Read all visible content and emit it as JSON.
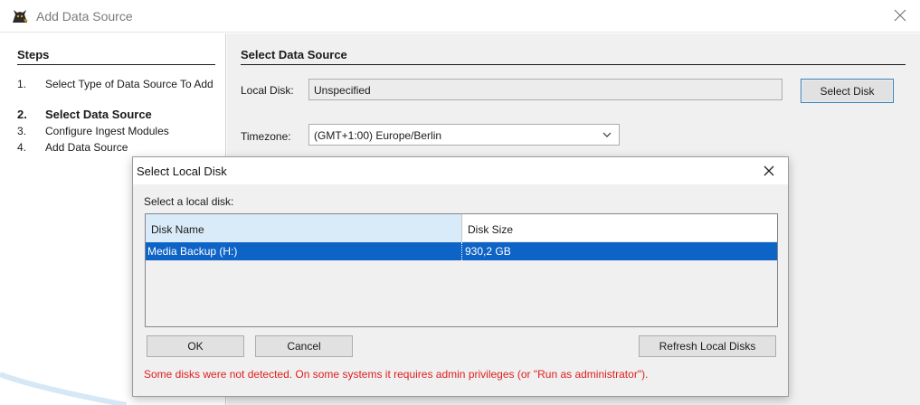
{
  "window": {
    "title": "Add Data Source"
  },
  "steps": {
    "title": "Steps",
    "items": [
      {
        "num": "1.",
        "label": "Select Type of Data Source To Add"
      },
      {
        "num": "2.",
        "label": "Select Data Source"
      },
      {
        "num": "3.",
        "label": "Configure Ingest Modules"
      },
      {
        "num": "4.",
        "label": "Add Data Source"
      }
    ]
  },
  "content": {
    "title": "Select Data Source",
    "local_disk_label": "Local Disk:",
    "local_disk_value": "Unspecified",
    "select_disk_button": "Select Disk",
    "timezone_label": "Timezone:",
    "timezone_value": "(GMT+1:00) Europe/Berlin"
  },
  "dialog": {
    "title": "Select Local Disk",
    "prompt": "Select a local disk:",
    "columns": [
      "Disk Name",
      "Disk Size"
    ],
    "rows": [
      {
        "name": "Media Backup (H:)",
        "size": "930,2 GB"
      }
    ],
    "ok_button": "OK",
    "cancel_button": "Cancel",
    "refresh_button": "Refresh Local Disks",
    "warning": "Some disks were not detected. On some systems it requires admin privileges (or \"Run as administrator\")."
  },
  "colors": {
    "selection": "#0e63c6",
    "warning": "#e01e1e",
    "header_highlight": "#d9ebf9"
  },
  "icons": {
    "app": "autopsy-dog-icon",
    "close": "close-icon",
    "dropdown": "chevron-down-icon"
  }
}
